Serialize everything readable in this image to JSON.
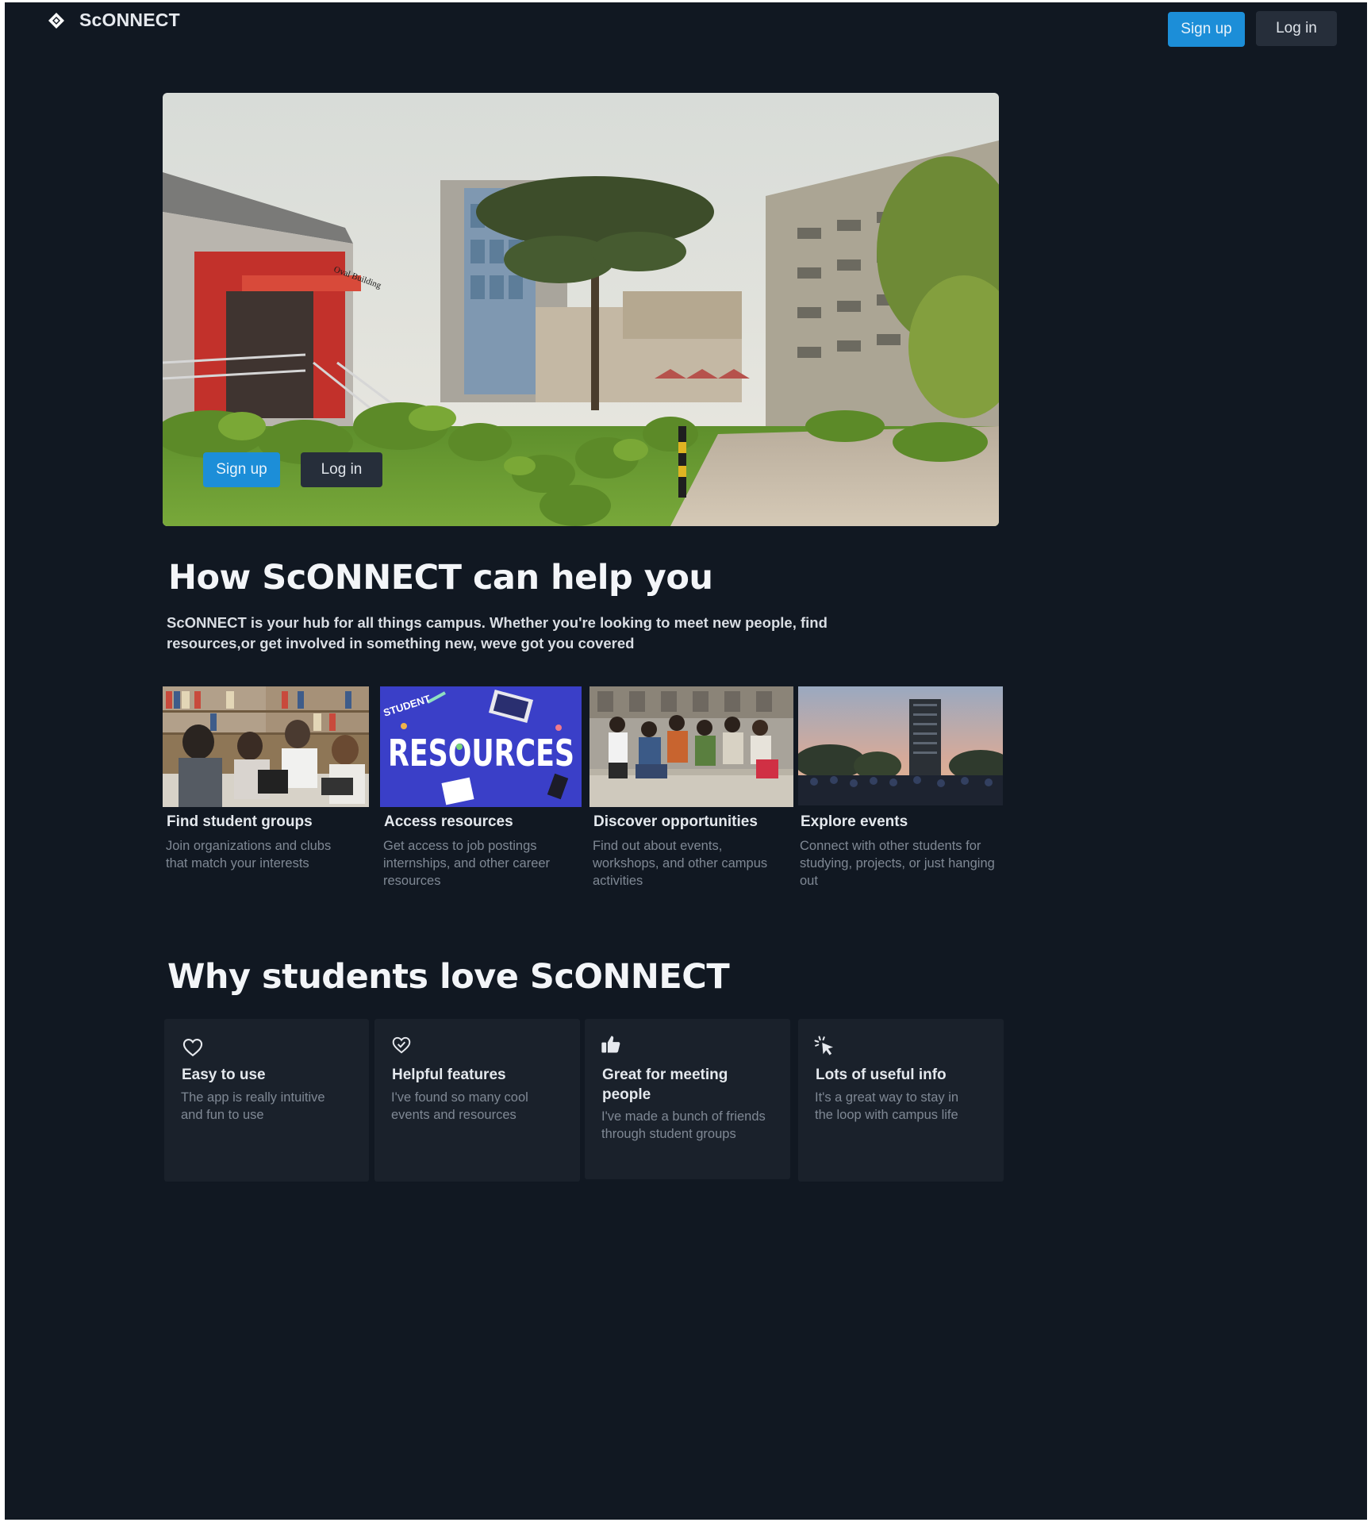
{
  "brand": {
    "name": "ScONNECT",
    "logo_icon": "diamond-logo-icon"
  },
  "nav": {
    "signup_label": "Sign up",
    "login_label": "Log in"
  },
  "hero": {
    "signup_label": "Sign up",
    "login_label": "Log in",
    "building_sign": "Oval Building"
  },
  "help": {
    "title": "How ScONNECT can help you",
    "description": "ScONNECT is your hub for all things campus. Whether you're looking to meet new people, find resources,or get involved in something new, weve got you covered",
    "features": [
      {
        "title": "Find student groups",
        "description": "Join organizations and clubs that match your interests"
      },
      {
        "title": "Access resources",
        "description": "Get access to job postings internships, and other career resources",
        "image_text_top": "STUDENT",
        "image_text_main": "RESOURCES"
      },
      {
        "title": "Discover opportunities",
        "description": "Find out about events, workshops, and other campus activities"
      },
      {
        "title": "Explore events",
        "description": "Connect with other students for studying, projects, or just hanging out"
      }
    ]
  },
  "love": {
    "title": "Why students love ScONNECT",
    "cards": [
      {
        "icon": "heart-icon",
        "title": "Easy to use",
        "description": "The app is really intuitive and fun to use"
      },
      {
        "icon": "heart-check-icon",
        "title": "Helpful features",
        "description": "I've found so many cool events and resources"
      },
      {
        "icon": "thumbs-up-icon",
        "title": "Great for meeting people",
        "description": "I've made a bunch of friends through student groups"
      },
      {
        "icon": "cursor-click-icon",
        "title": "Lots of useful info",
        "description": "It's a great way to stay in the loop with campus life"
      }
    ]
  },
  "colors": {
    "background": "#111822",
    "primary": "#1c8ed8",
    "card": "#1a212b"
  }
}
